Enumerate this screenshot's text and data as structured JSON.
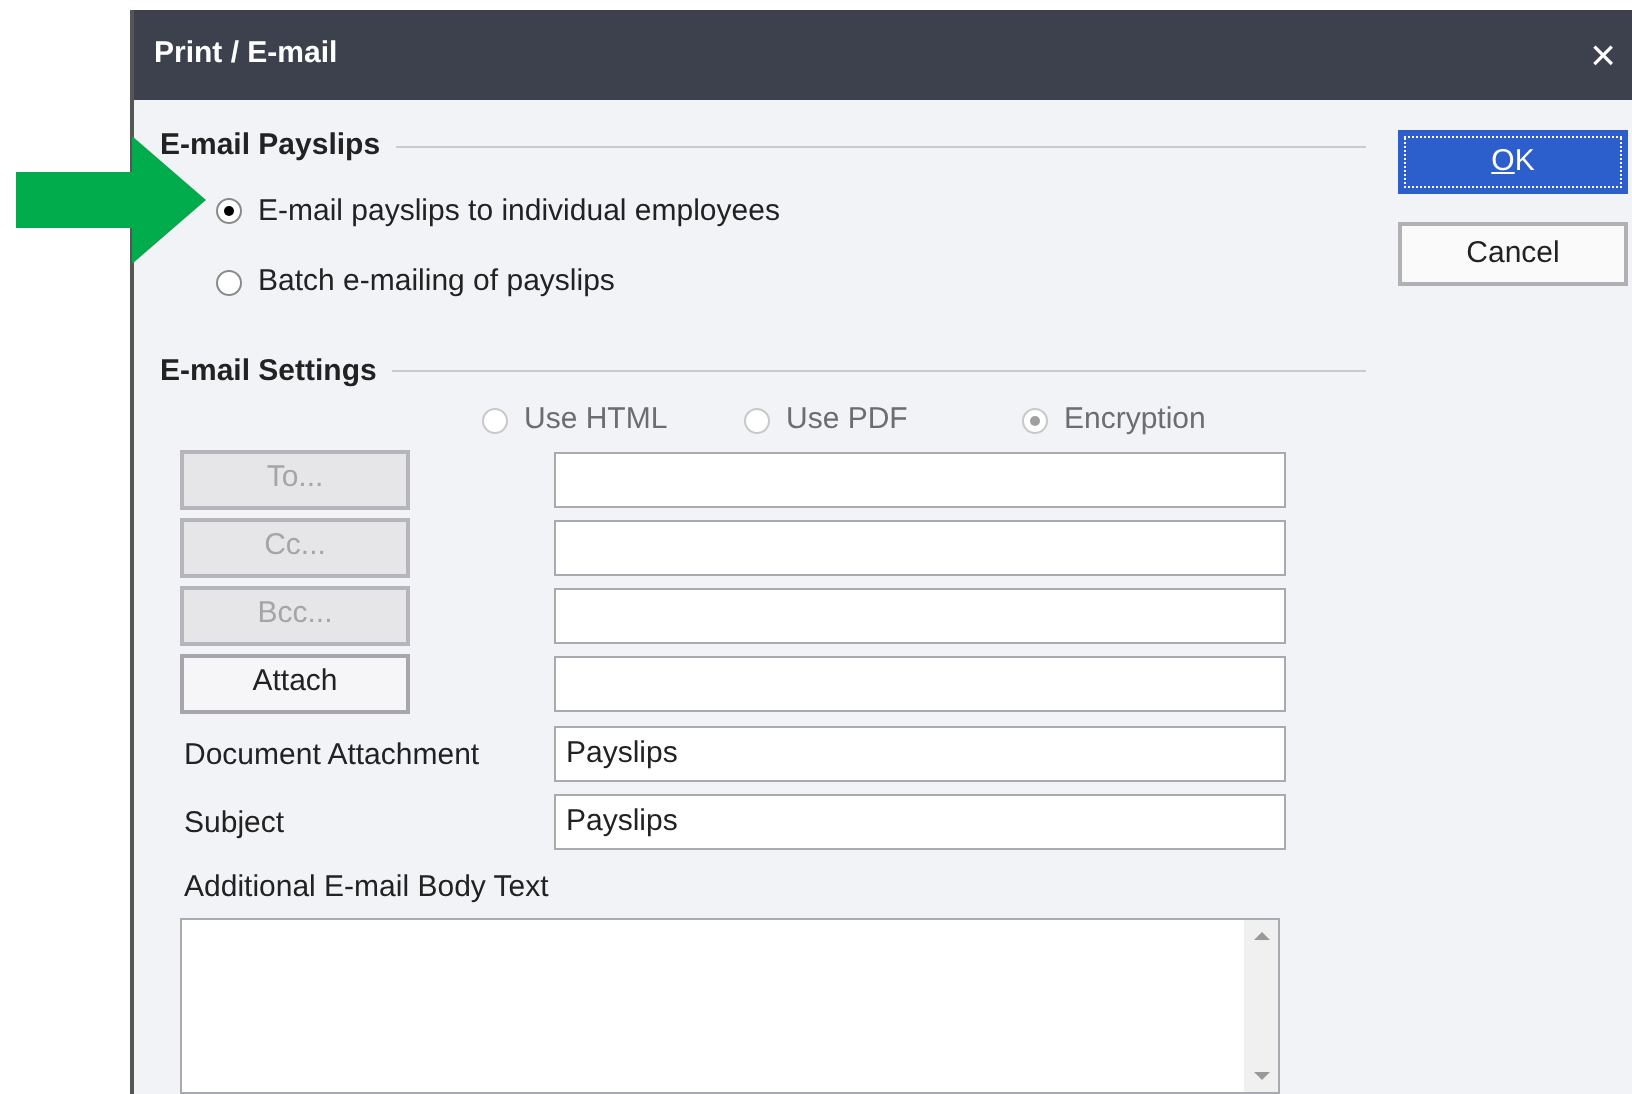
{
  "window": {
    "title": "Print / E-mail",
    "close": "×"
  },
  "email_payslips": {
    "heading": "E-mail Payslips",
    "options": [
      {
        "label": "E-mail payslips to individual employees",
        "selected": true
      },
      {
        "label": "Batch e-mailing of payslips",
        "selected": false
      }
    ]
  },
  "email_settings": {
    "heading": "E-mail Settings",
    "formats": [
      {
        "label": "Use HTML",
        "selected": false,
        "disabled": true
      },
      {
        "label": "Use PDF",
        "selected": false,
        "disabled": true
      },
      {
        "label": "Encryption",
        "selected": true,
        "disabled": true
      }
    ],
    "address_rows": [
      {
        "button": "To...",
        "disabled": true
      },
      {
        "button": "Cc...",
        "disabled": true
      },
      {
        "button": "Bcc...",
        "disabled": true
      },
      {
        "button": "Attach",
        "disabled": false
      }
    ],
    "fields": [
      {
        "label": "Document Attachment",
        "value": "Payslips"
      },
      {
        "label": "Subject",
        "value": "Payslips"
      }
    ],
    "body": {
      "label": "Additional E-mail Body Text"
    }
  },
  "buttons": [
    {
      "label": "OK",
      "default": true
    },
    {
      "label": "Cancel",
      "default": false
    }
  ]
}
